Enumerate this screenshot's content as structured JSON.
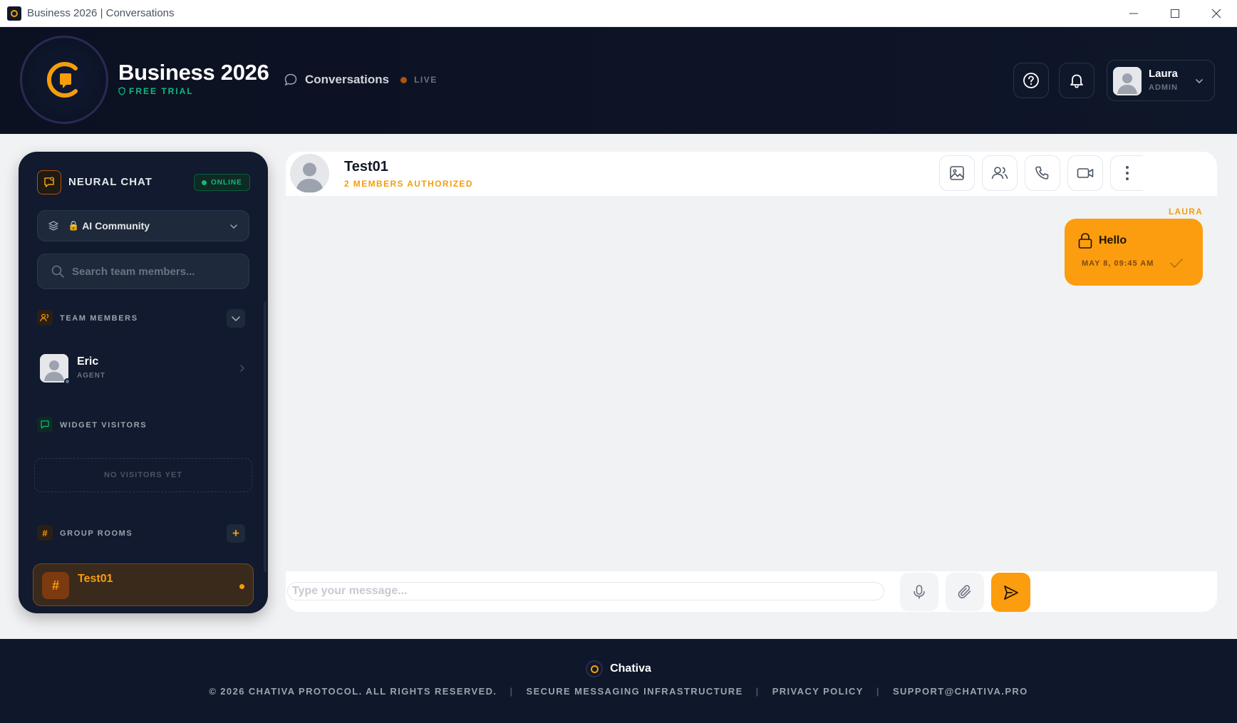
{
  "window": {
    "title": "Business 2026 | Conversations"
  },
  "header": {
    "brand_title": "Business 2026",
    "plan_badge": "FREE TRIAL",
    "section_label": "Conversations",
    "live_label": "LIVE",
    "user": {
      "name": "Laura",
      "role": "ADMIN"
    }
  },
  "sidebar": {
    "title": "NEURAL CHAT",
    "status": "ONLINE",
    "community": {
      "selected": "AI Community",
      "lock_glyph": "🔒"
    },
    "search": {
      "placeholder": "Search team members..."
    },
    "team_members": {
      "title": "TEAM MEMBERS",
      "items": [
        {
          "name": "Eric",
          "role": "AGENT"
        }
      ]
    },
    "widget_visitors": {
      "title": "WIDGET VISITORS",
      "empty_text": "NO VISITORS YET"
    },
    "group_rooms": {
      "title": "GROUP ROOMS",
      "add_label": "+",
      "items": [
        {
          "name": "Test01",
          "hash": "#"
        }
      ]
    }
  },
  "chat": {
    "room_name": "Test01",
    "members_label": "2 MEMBERS AUTHORIZED",
    "messages": [
      {
        "sender": "LAURA",
        "text": "Hello",
        "time": "MAY 8, 09:45 AM"
      }
    ],
    "composer": {
      "placeholder": "Type your message..."
    }
  },
  "footer": {
    "brand": "Chativa",
    "links": [
      "© 2026 CHATIVA PROTOCOL. ALL RIGHTS RESERVED.",
      "SECURE MESSAGING INFRASTRUCTURE",
      "PRIVACY POLICY",
      "SUPPORT@CHATIVA.PRO"
    ],
    "separator": "|"
  },
  "colors": {
    "accent": "#fb9d0e",
    "navy": "#0b1121",
    "online": "#10b981"
  },
  "icons": [
    "app-icon",
    "minimize-icon",
    "maximize-icon",
    "close-icon",
    "logo-icon",
    "shield-icon",
    "chat-bubble-icon",
    "help-icon",
    "bell-icon",
    "avatar-icon",
    "chevron-down-icon",
    "layers-icon",
    "lock-icon",
    "search-icon",
    "users-icon",
    "chevron-right-icon",
    "message-square-icon",
    "hash-icon",
    "plus-icon",
    "image-icon",
    "phone-icon",
    "video-icon",
    "more-vertical-icon",
    "check-icon",
    "mic-icon",
    "paperclip-icon",
    "send-icon"
  ]
}
